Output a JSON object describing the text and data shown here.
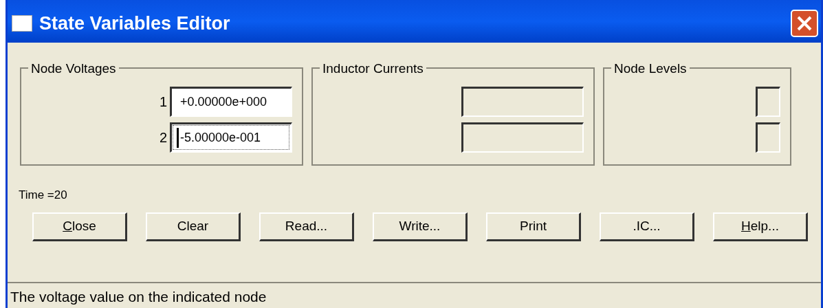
{
  "window": {
    "title": "State Variables Editor"
  },
  "groups": [
    {
      "title": "Node Voltages",
      "fields": [
        {
          "label": "1",
          "value": "+0.00000e+000",
          "focused": false,
          "enabled": true
        },
        {
          "label": "2",
          "value": "-5.00000e-001",
          "focused": true,
          "enabled": true
        }
      ]
    },
    {
      "title": "Inductor Currents",
      "fields": [
        {
          "enabled": false
        },
        {
          "enabled": false
        }
      ]
    },
    {
      "title": "Node Levels",
      "fields": [
        {
          "enabled": false
        },
        {
          "enabled": false
        }
      ]
    }
  ],
  "time": "Time =20",
  "buttons": [
    {
      "label": "Close",
      "mnemonic": true
    },
    {
      "label": "Clear",
      "mnemonic": false
    },
    {
      "label": "Read...",
      "mnemonic": false
    },
    {
      "label": "Write...",
      "mnemonic": false
    },
    {
      "label": "Print",
      "mnemonic": false
    },
    {
      "label": ".IC...",
      "mnemonic": false
    },
    {
      "label": "Help...",
      "mnemonic": true
    }
  ],
  "status_bar": "The voltage value on the indicated node"
}
